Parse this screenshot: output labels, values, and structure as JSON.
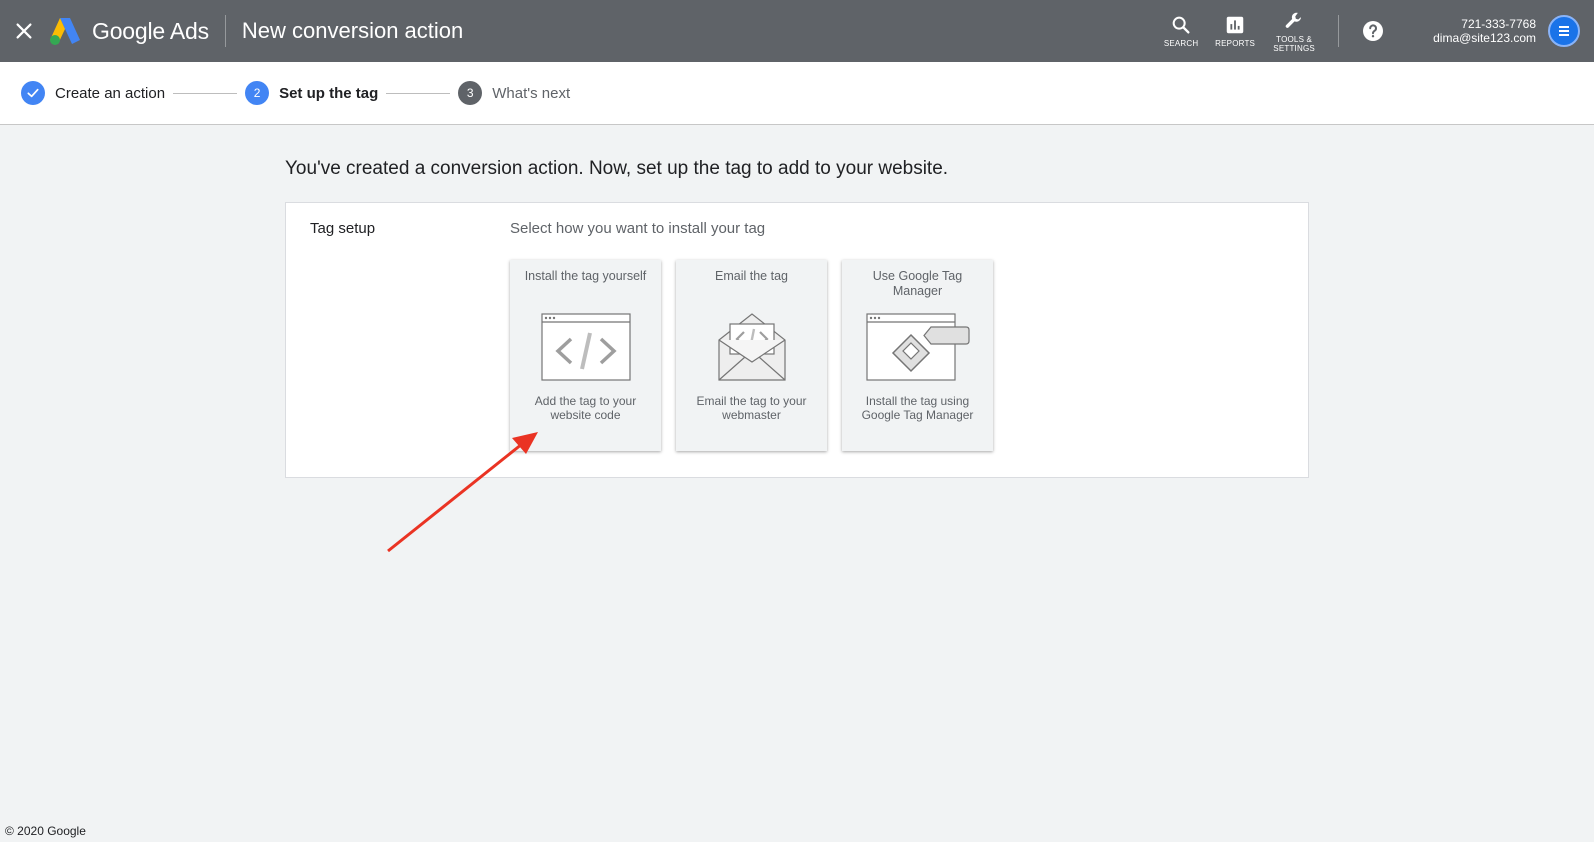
{
  "topbar": {
    "close_icon": "close-icon",
    "brand": "Google Ads",
    "title": "New conversion action",
    "tools": [
      {
        "label": "SEARCH",
        "icon": "search-icon"
      },
      {
        "label": "REPORTS",
        "icon": "reports-icon"
      },
      {
        "label": "TOOLS & SETTINGS",
        "icon": "wrench-icon"
      }
    ],
    "help_icon": "help-icon",
    "account": {
      "phone": "721-333-7768",
      "email": "dima@site123.com"
    },
    "colors": {
      "bar": "#5f6368",
      "accent": "#4285f4"
    }
  },
  "stepper": {
    "steps": [
      {
        "number": "",
        "label": "Create an action",
        "state": "done"
      },
      {
        "number": "2",
        "label": "Set up the tag",
        "state": "active"
      },
      {
        "number": "3",
        "label": "What's next",
        "state": "todo"
      }
    ]
  },
  "main": {
    "heading": "You've created a conversion action. Now, set up the tag to add to your website.",
    "panel": {
      "label": "Tag setup",
      "hint": "Select how you want to install your tag",
      "options": [
        {
          "title": "Install the tag yourself",
          "desc": "Add the tag to your website code",
          "icon": "code-window-icon"
        },
        {
          "title": "Email the tag",
          "desc": "Email the tag to your webmaster",
          "icon": "email-code-icon"
        },
        {
          "title": "Use Google Tag Manager",
          "desc": "Install the tag using Google Tag Manager",
          "icon": "tag-manager-icon"
        }
      ]
    }
  },
  "annotation": {
    "arrow_color": "#ea3323"
  },
  "footer": {
    "copyright": "© 2020 Google"
  }
}
